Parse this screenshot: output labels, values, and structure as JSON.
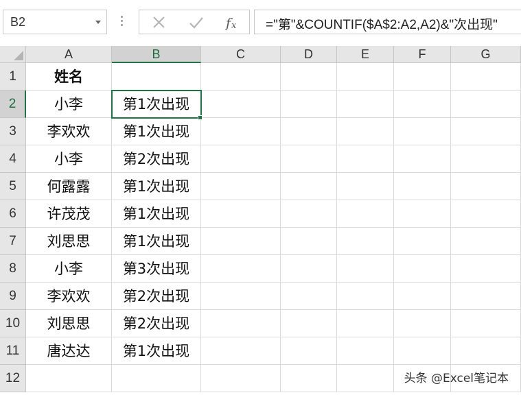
{
  "name_box": {
    "value": "B2"
  },
  "formula_bar": {
    "cancel_glyph": "✕",
    "enter_glyph": "✓",
    "fx_label": "fx",
    "formula": "=\"第\"&COUNTIF($A$2:A2,A2)&\"次出现\""
  },
  "columns": [
    "A",
    "B",
    "C",
    "D",
    "E",
    "F",
    "G"
  ],
  "selected_column": "B",
  "selected_row": "2",
  "rows": [
    {
      "num": "1",
      "a": "姓名",
      "b": ""
    },
    {
      "num": "2",
      "a": "小李",
      "b": "第1次出现"
    },
    {
      "num": "3",
      "a": "李欢欢",
      "b": "第1次出现"
    },
    {
      "num": "4",
      "a": "小李",
      "b": "第2次出现"
    },
    {
      "num": "5",
      "a": "何露露",
      "b": "第1次出现"
    },
    {
      "num": "6",
      "a": "许茂茂",
      "b": "第1次出现"
    },
    {
      "num": "7",
      "a": "刘思思",
      "b": "第1次出现"
    },
    {
      "num": "8",
      "a": "小李",
      "b": "第3次出现"
    },
    {
      "num": "9",
      "a": "李欢欢",
      "b": "第2次出现"
    },
    {
      "num": "10",
      "a": "刘思思",
      "b": "第2次出现"
    },
    {
      "num": "11",
      "a": "唐达达",
      "b": "第1次出现"
    },
    {
      "num": "12",
      "a": "",
      "b": ""
    }
  ],
  "watermark": "头条 @Excel笔记本",
  "colors": {
    "accent": "#217346",
    "header_bg": "#e6e6e6",
    "header_sel_bg": "#d2d2d2",
    "gridline": "#dadada"
  }
}
